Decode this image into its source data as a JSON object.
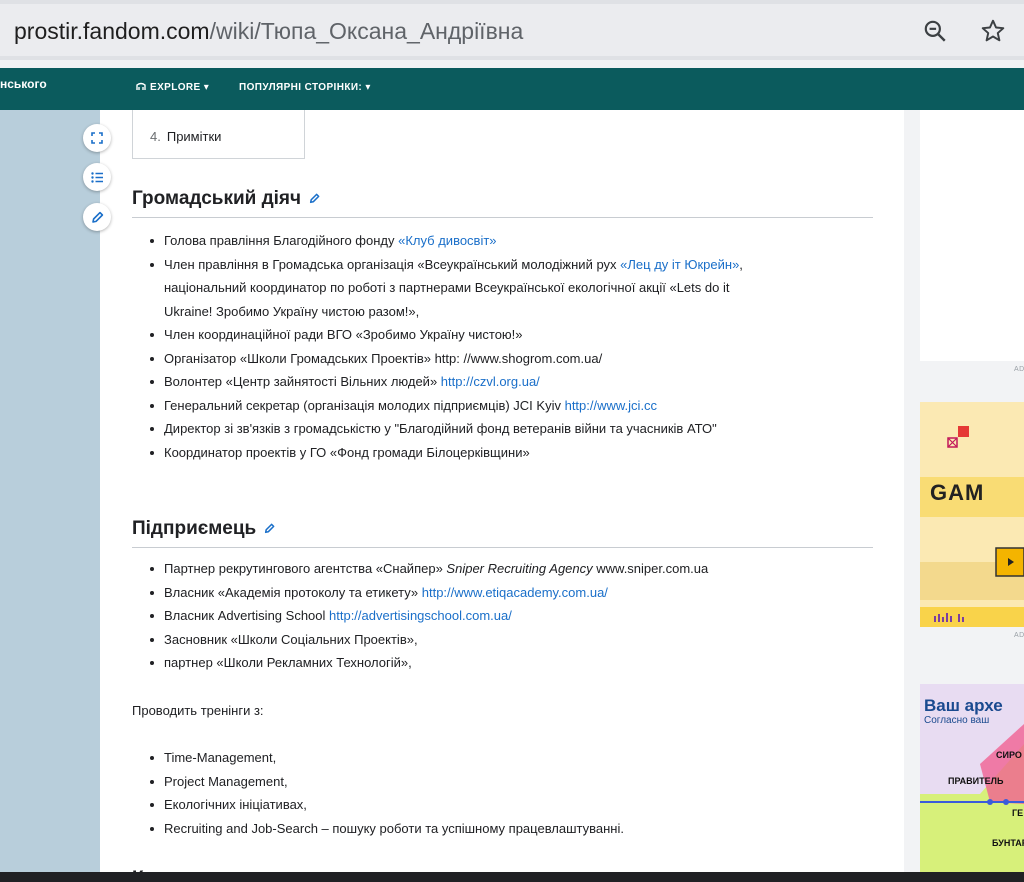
{
  "browser": {
    "url_domain": "prostir.fandom.com",
    "url_path": "/wiki/Тюпа_Оксана_Андріївна"
  },
  "header": {
    "wiki_name": "нського",
    "explore_label": "EXPLORE",
    "popular_label": "ПОПУЛЯРНІ СТОРІНКИ:"
  },
  "toc": {
    "items": [
      {
        "num": "4.",
        "label": "Примітки"
      }
    ]
  },
  "sections": [
    {
      "title": "Громадський діяч",
      "items": [
        {
          "text": "Голова правління Благодійного фонду ",
          "link": "«Клуб дивосвіт»"
        },
        {
          "text": "Член правління в Громадська організація «Всеукраїнський молодіжний рух ",
          "link": "«Лец ду іт Юкрейн»",
          "after": ",",
          "cont1": "національний координатор по роботі з партнерами Всеукраїнської екологічної акції «Lets do it",
          "cont2": "Ukraine! Зробимо Україну чистою разом!»,"
        },
        {
          "text": "Член координаційної ради ВГО «Зробимо Україну чистою!»"
        },
        {
          "text": "Організатор «Школи Громадських Проектів» http: //www.shogrom.com.ua/"
        },
        {
          "text": "Волонтер «Центр зайнятості Вільних людей» ",
          "link": "http://czvl.org.ua/"
        },
        {
          "text": "Генеральний секретар (організація молодих підприємців) JCI Kyiv ",
          "link": "http://www.jci.cc"
        },
        {
          "text": "Директор зі зв'язків з громадськістю у \"Благодійний фонд ветеранів війни та учасників АТО\""
        },
        {
          "text": "Координатор проектів у ГО «Фонд громади Білоцерківщини»"
        }
      ]
    },
    {
      "title": "Підприємець",
      "items": [
        {
          "text": "Партнер рекрутингового агентства «Снайпер» ",
          "italic": "Sniper Recruiting Agency",
          "after": " www.sniper.com.ua"
        },
        {
          "text": "Власник «Академія протоколу та етикету» ",
          "link": "http://www.etiqacademy.com.ua/"
        },
        {
          "text": "Власник Advertising School ",
          "link": "http://advertisingschool.com.ua/"
        },
        {
          "text": "Засновник «Школи Соціальних Проектів»,"
        },
        {
          "text": "партнер «Школи Рекламних Технологій»,"
        }
      ],
      "paragraph": "Проводить тренінги з:",
      "trainings": [
        "Time-Management,",
        "Project Management,",
        "Екологічних ініціативах,",
        "Recruiting and Job-Search – пошуку роботи та успішному працевлаштуванні."
      ]
    }
  ],
  "next_heading": "К",
  "ads": {
    "label": "AD",
    "game_text": "GAM",
    "arch_title": "Ваш архе",
    "arch_sub": "Согласно ваш",
    "arch_words": [
      "СИРО",
      "ПРАВИТЕЛЬ",
      "ГЕ",
      "БУНТАР"
    ]
  },
  "colors": {
    "header_bg": "#0b5b5d",
    "link": "#1a6fc9",
    "rail": "#b8cedb"
  }
}
